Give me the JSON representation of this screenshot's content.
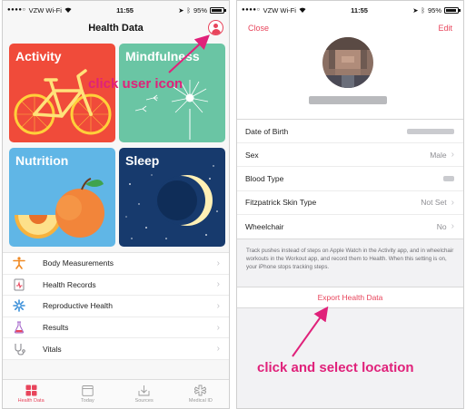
{
  "left": {
    "status": {
      "carrier": "VZW Wi-Fi",
      "time": "11:55",
      "battery": "95%",
      "battery_level": 0.95
    },
    "title": "Health Data",
    "tiles": {
      "activity": "Activity",
      "mindfulness": "Mindfulness",
      "nutrition": "Nutrition",
      "sleep": "Sleep"
    },
    "categories": [
      {
        "label": "Body Measurements",
        "icon": "body-measurements-icon"
      },
      {
        "label": "Health Records",
        "icon": "health-records-icon"
      },
      {
        "label": "Reproductive Health",
        "icon": "reproductive-health-icon"
      },
      {
        "label": "Results",
        "icon": "results-flask-icon"
      },
      {
        "label": "Vitals",
        "icon": "vitals-stethoscope-icon"
      }
    ],
    "tabs": [
      {
        "label": "Health Data",
        "icon": "health-data-grid-icon",
        "active": true
      },
      {
        "label": "Today",
        "icon": "calendar-icon",
        "active": false
      },
      {
        "label": "Sources",
        "icon": "sources-download-icon",
        "active": false
      },
      {
        "label": "Medical ID",
        "icon": "medical-id-icon",
        "active": false
      }
    ]
  },
  "right": {
    "status": {
      "carrier": "VZW Wi-Fi",
      "time": "11:55",
      "battery": "95%",
      "battery_level": 0.95
    },
    "nav": {
      "close": "Close",
      "edit": "Edit"
    },
    "fields": [
      {
        "label": "Date of Birth",
        "value": ""
      },
      {
        "label": "Sex",
        "value": "Male"
      },
      {
        "label": "Blood Type",
        "value": ""
      },
      {
        "label": "Fitzpatrick Skin Type",
        "value": "Not Set"
      },
      {
        "label": "Wheelchair",
        "value": "No"
      }
    ],
    "footnote": "Track pushes instead of steps on Apple Watch in the Activity app, and in wheelchair workouts in the Workout app, and record them to Health. When this setting is on, your iPhone stops tracking steps.",
    "export_label": "Export Health Data"
  },
  "annotations": {
    "click_user_icon": "click user icon",
    "click_select_location": "click and select location"
  },
  "colors": {
    "accent": "#e8455c",
    "annotation": "#e0217a",
    "activity": "#f04b3a",
    "mindfulness": "#6ac5a4",
    "nutrition": "#60b6e6",
    "sleep": "#173a6d"
  }
}
